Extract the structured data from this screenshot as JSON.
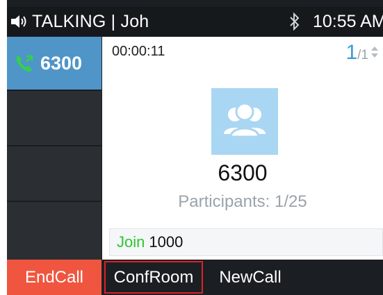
{
  "statusbar": {
    "status_text": "TALKING | Joh",
    "clock": "10:55 AM"
  },
  "lines": [
    {
      "label": "6300",
      "active": true
    }
  ],
  "call": {
    "duration": "00:00:11",
    "page_current": "1",
    "page_total": "1",
    "conference_number": "6300",
    "participants_text": "Participants: 1/25",
    "join_label": "Join",
    "join_number": "1000"
  },
  "softkeys": {
    "end_call": "EndCall",
    "conf_room": "ConfRoom",
    "new_call": "NewCall"
  },
  "colors": {
    "active_line": "#4f95c8",
    "end_call": "#f0553f",
    "join_green": "#2fc52f",
    "page_blue": "#3d9ad6",
    "highlight_border": "#e0202a"
  }
}
